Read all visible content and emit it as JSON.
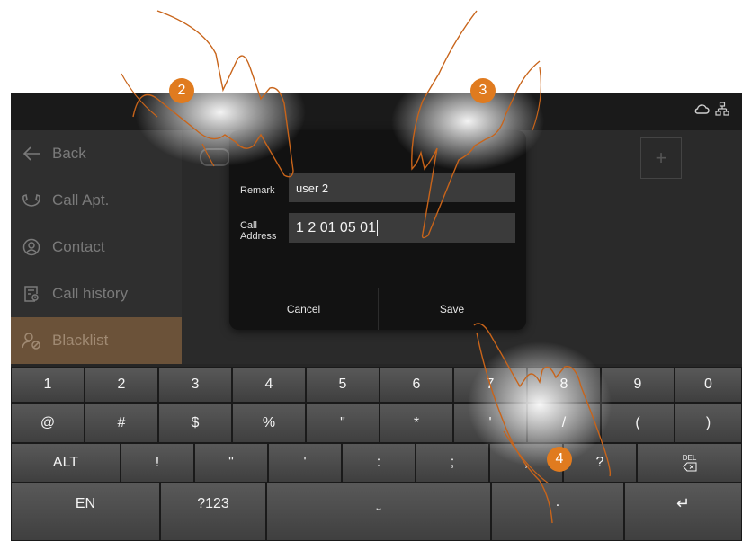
{
  "status": {
    "icons": [
      "cloud-icon",
      "network-icon"
    ]
  },
  "sidebar": {
    "items": [
      {
        "label": "Back",
        "icon": "arrow-left-icon"
      },
      {
        "label": "Call Apt.",
        "icon": "handset-icon"
      },
      {
        "label": "Contact",
        "icon": "person-circle-icon"
      },
      {
        "label": "Call history",
        "icon": "history-icon"
      },
      {
        "label": "Blacklist",
        "icon": "blacklist-icon",
        "active": true
      }
    ]
  },
  "dialog": {
    "remark_label": "Remark",
    "remark_value": "user 2",
    "address_label_line1": "Call",
    "address_label_line2": "Address",
    "address_value": "1 2 01 05 01",
    "cancel_label": "Cancel",
    "save_label": "Save"
  },
  "keyboard": {
    "row1": [
      "1",
      "2",
      "3",
      "4",
      "5",
      "6",
      "7",
      "8",
      "9",
      "0"
    ],
    "row2": [
      "@",
      "#",
      "$",
      "%",
      "\"",
      "*",
      "'",
      "/",
      "(",
      ")"
    ],
    "row3": [
      "ALT",
      "!",
      "\"",
      "'",
      ":",
      ";",
      ",",
      "?"
    ],
    "del_label": "DEL",
    "row4": {
      "lang": "EN",
      "symbols": "?123",
      "space": "⎵",
      "period": ".",
      "enter": "↵"
    }
  },
  "callouts": [
    "2",
    "3",
    "4"
  ],
  "colors": {
    "accent": "#e07b1f",
    "sidebar_active": "#6b5239"
  }
}
